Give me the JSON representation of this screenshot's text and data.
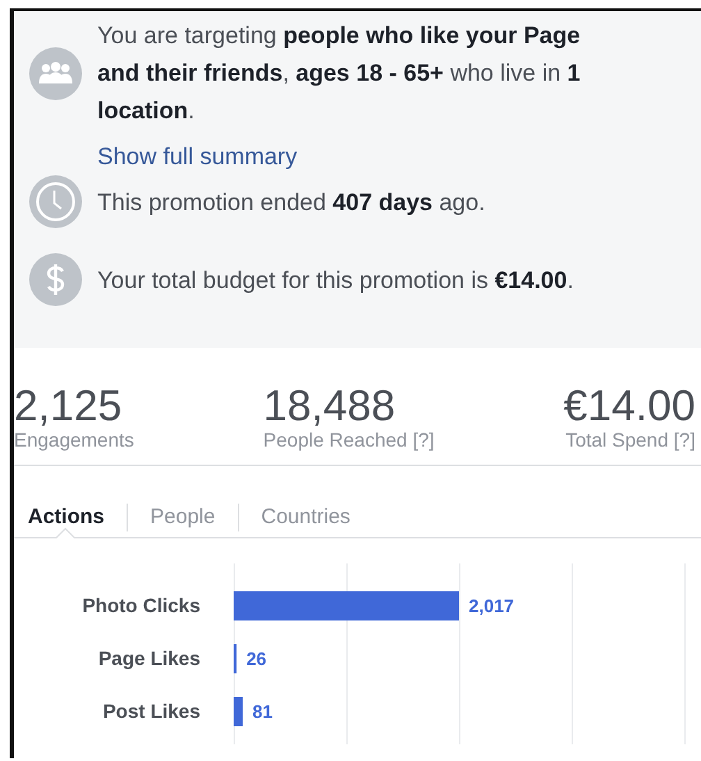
{
  "summary": [
    {
      "kind": "audience",
      "text": "You are targeting **people who like your Page and their friends**, **ages 18 - 65+** who live in **1 location**."
    },
    {
      "kind": "link",
      "text": "Show full summary"
    },
    {
      "kind": "time",
      "text": "This promotion ended **407 days** ago."
    },
    {
      "kind": "budget",
      "text": "Your total budget for this promotion is **€14.00**."
    }
  ],
  "stats": [
    {
      "value": "2,125",
      "label": "Engagements"
    },
    {
      "value": "18,488",
      "label": "People Reached",
      "hint": "[?]"
    },
    {
      "value": "€14.00",
      "label": "Total Spend",
      "hint": "[?]"
    }
  ],
  "tabs": [
    {
      "label": "Actions",
      "selected": true
    },
    {
      "label": "People",
      "selected": false
    },
    {
      "label": "Countries",
      "selected": false
    }
  ],
  "chart_data": {
    "type": "bar",
    "orientation": "horizontal",
    "categories": [
      "Photo Clicks",
      "Page Likes",
      "Post Likes"
    ],
    "values": [
      2017,
      26,
      81
    ],
    "value_labels": [
      "2,017",
      "26",
      "81"
    ]
  }
}
